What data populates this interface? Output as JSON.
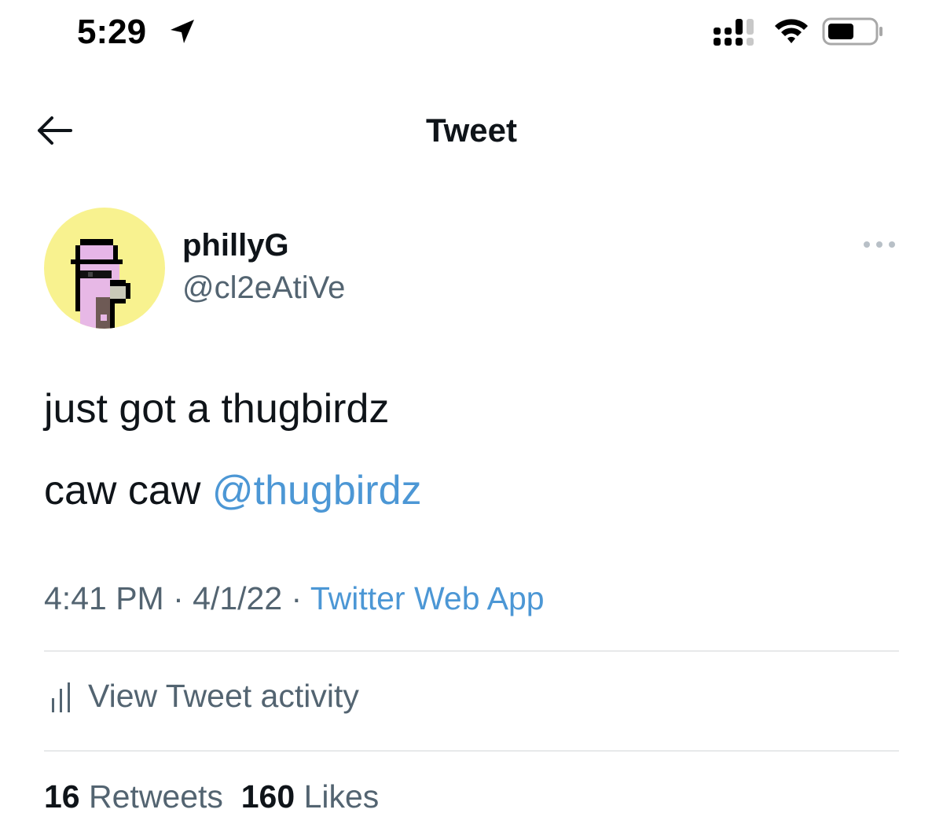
{
  "status_bar": {
    "time": "5:29",
    "icons": [
      "location-arrow-icon",
      "cellular-signal-icon",
      "wifi-icon",
      "battery-icon"
    ]
  },
  "nav": {
    "back_icon": "arrow-left-icon",
    "title": "Tweet"
  },
  "tweet": {
    "author": {
      "display_name": "phillyG",
      "handle": "@cl2eAtiVe",
      "avatar": "pixel-bird-avatar"
    },
    "more_icon": "ellipsis-icon",
    "text_line1": "just got a thugbirdz",
    "text_line2_prefix": "caw caw ",
    "mention": "@thugbirdz",
    "time": "4:41 PM",
    "separator": " · ",
    "date": "4/1/22",
    "source": "Twitter Web App",
    "activity_label": "View Tweet activity",
    "retweet_count": "16",
    "retweet_label": "Retweets",
    "like_count": "160",
    "like_label": "Likes"
  },
  "colors": {
    "link": "#4c97d5",
    "secondary_text": "#536471",
    "avatar_bg": "#f8f28f",
    "divider": "#e7e9ea"
  }
}
